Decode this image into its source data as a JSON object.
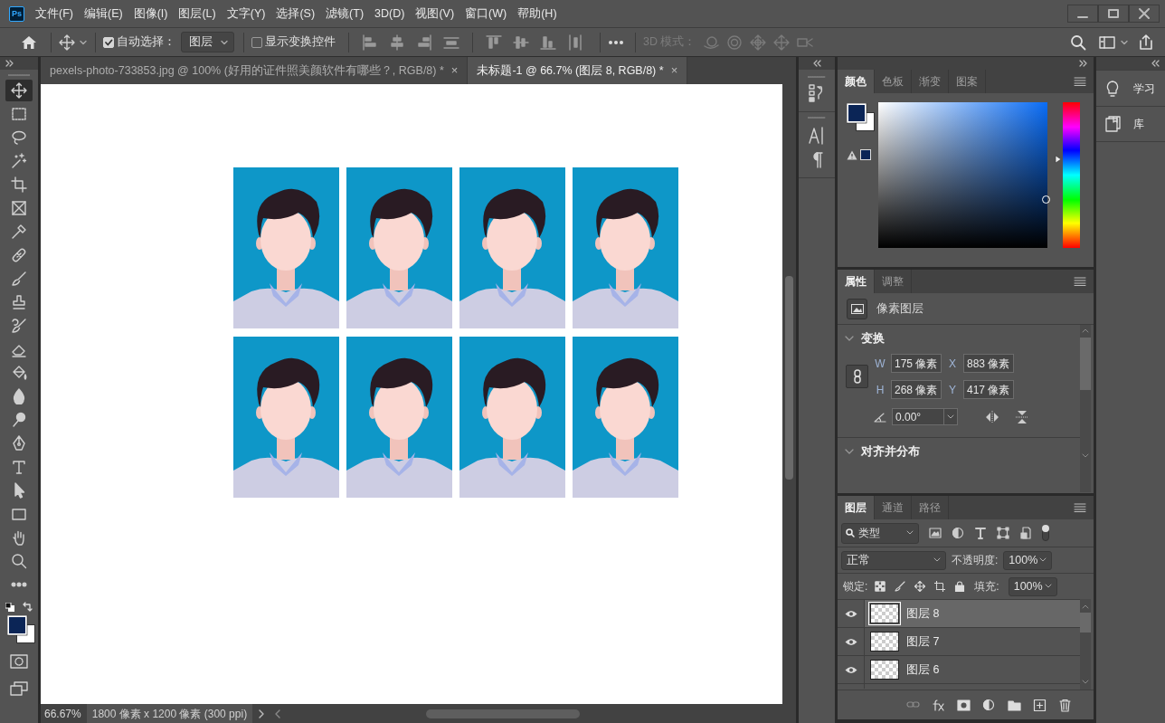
{
  "app": {
    "icon_text": "Ps"
  },
  "menu": [
    "文件(F)",
    "编辑(E)",
    "图像(I)",
    "图层(L)",
    "文字(Y)",
    "选择(S)",
    "滤镜(T)",
    "3D(D)",
    "视图(V)",
    "窗口(W)",
    "帮助(H)"
  ],
  "options_bar": {
    "auto_select": {
      "label": "自动选择：",
      "checked": true
    },
    "auto_select_target": "图层",
    "show_transform": {
      "label": "显示变换控件",
      "checked": false
    },
    "mode_3d": {
      "label": "3D 模式：",
      "disabled": true
    }
  },
  "document_tabs": [
    {
      "title": "pexels-photo-733853.jpg @ 100% (好用的证件照美颜软件有哪些？, RGB/8) *",
      "close": "×",
      "selected": false
    },
    {
      "title": "未标题-1 @ 66.7% (图层 8, RGB/8) *",
      "close": "×",
      "selected": true
    }
  ],
  "tools": [
    {
      "kind": "move",
      "selected": true
    },
    {
      "kind": "marquee",
      "selected": false
    },
    {
      "kind": "lasso",
      "selected": false
    },
    {
      "kind": "wand",
      "selected": false
    },
    {
      "kind": "crop",
      "selected": false
    },
    {
      "kind": "frame",
      "selected": false
    },
    {
      "kind": "eyedropper",
      "selected": false
    },
    {
      "kind": "heal",
      "selected": false
    },
    {
      "kind": "brush",
      "selected": false
    },
    {
      "kind": "stamp",
      "selected": false
    },
    {
      "kind": "history",
      "selected": false
    },
    {
      "kind": "eraser",
      "selected": false
    },
    {
      "kind": "bucket",
      "selected": false
    },
    {
      "kind": "blur",
      "selected": false
    },
    {
      "kind": "dodge",
      "selected": false
    },
    {
      "kind": "pen",
      "selected": false
    },
    {
      "kind": "type",
      "selected": false
    },
    {
      "kind": "select",
      "selected": false
    },
    {
      "kind": "shape",
      "selected": false
    },
    {
      "kind": "hand",
      "selected": false
    },
    {
      "kind": "zoom",
      "selected": false
    },
    {
      "kind": "more",
      "selected": false
    }
  ],
  "status_bar": {
    "zoom": "66.67%",
    "document_info": "1800 像素 x 1200 像素 (300 ppi)"
  },
  "color_panel": {
    "tabs": [
      {
        "label": "颜色",
        "selected": true
      },
      {
        "label": "色板",
        "selected": false
      },
      {
        "label": "渐变",
        "selected": false
      },
      {
        "label": "图案",
        "selected": false
      }
    ]
  },
  "properties_panel": {
    "tabs": [
      {
        "label": "属性",
        "selected": true
      },
      {
        "label": "调整",
        "selected": false
      }
    ],
    "layer_type": "像素图层",
    "sections": [
      {
        "title": "变换",
        "expanded": true
      },
      {
        "title": "对齐并分布",
        "expanded": true
      }
    ],
    "transform": {
      "w_label": "W",
      "w": "175 像素",
      "x_label": "X",
      "x": "883 像素",
      "h_label": "H",
      "h": "268 像素",
      "y_label": "Y",
      "y": "417 像素",
      "angle": "0.00°"
    }
  },
  "layers_panel": {
    "tabs": [
      {
        "label": "图层",
        "selected": true
      },
      {
        "label": "通道",
        "selected": false
      },
      {
        "label": "路径",
        "selected": false
      }
    ],
    "filter": "类型",
    "blend_mode": "正常",
    "opacity_label": "不透明度:",
    "opacity": "100%",
    "lock_label": "锁定:",
    "fill_label": "填充:",
    "fill": "100%",
    "layers": [
      {
        "name": "图层 8",
        "visible": true,
        "selected": true
      },
      {
        "name": "图层 7",
        "visible": true,
        "selected": false
      },
      {
        "name": "图层 6",
        "visible": true,
        "selected": false
      }
    ]
  },
  "right_dock": [
    {
      "kind": "learn",
      "label": "学习"
    },
    {
      "kind": "library",
      "label": "库"
    }
  ]
}
